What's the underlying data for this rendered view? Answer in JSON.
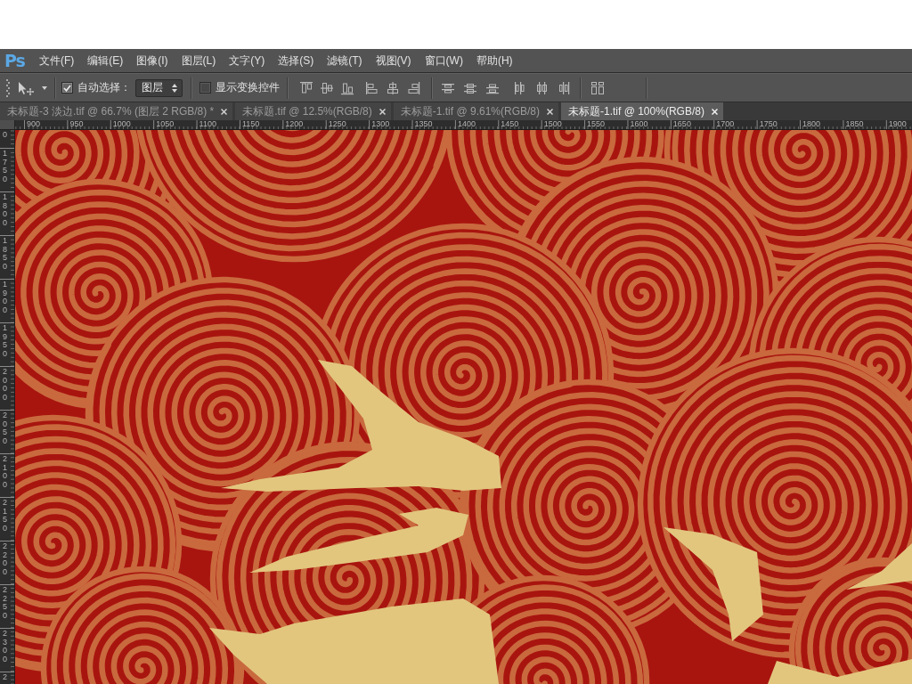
{
  "app_logo": "Ps",
  "menu_bar": [
    "文件(F)",
    "编辑(E)",
    "图像(I)",
    "图层(L)",
    "文字(Y)",
    "选择(S)",
    "滤镜(T)",
    "视图(V)",
    "窗口(W)",
    "帮助(H)"
  ],
  "options_bar": {
    "auto_select": {
      "label": "自动选择：",
      "checked": true
    },
    "auto_select_target": "图层",
    "show_transform_controls": {
      "label": "显示变换控件",
      "checked": false
    }
  },
  "tabs": [
    {
      "label": "未标题-3 淡边.tif @ 66.7% (图层 2 RGB/8) *",
      "selected": false
    },
    {
      "label": "未标题.tif @ 12.5%(RGB/8)",
      "selected": false
    },
    {
      "label": "未标题-1.tif @ 9.61%(RGB/8)",
      "selected": false
    },
    {
      "label": "未标题-1.tif @ 100%(RGB/8)",
      "selected": true
    }
  ],
  "horizontal_ruler": {
    "labels": [
      "900",
      "950",
      "1000",
      "1050",
      "1100",
      "1150",
      "1200",
      "1250",
      "1300",
      "1350",
      "1400",
      "1450",
      "1500",
      "1550",
      "1600",
      "1650",
      "1700",
      "1750",
      "1800",
      "1850",
      "1900"
    ]
  },
  "vertical_ruler": {
    "labels": [
      "0",
      "1750",
      "1800",
      "1850",
      "1900",
      "1950",
      "2000",
      "2050",
      "2100",
      "2150",
      "2200",
      "2250",
      "2300",
      "2"
    ]
  }
}
